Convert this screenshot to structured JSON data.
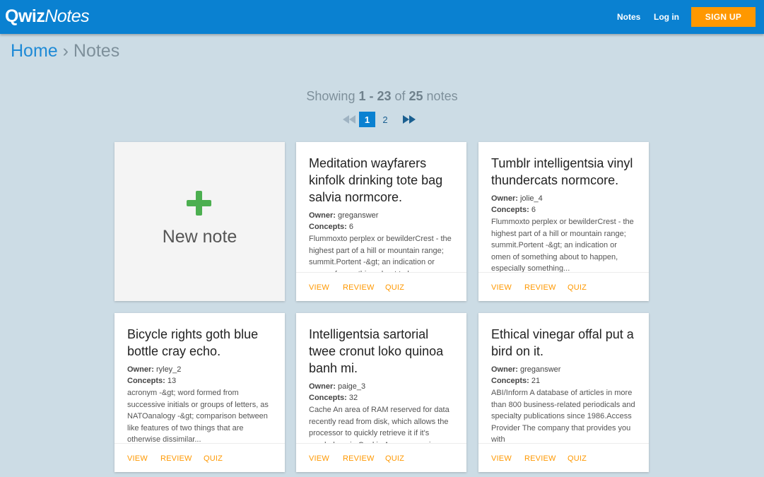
{
  "header": {
    "logo_bold": "Qwiz",
    "logo_italic": "Notes",
    "nav_notes": "Notes",
    "nav_login": "Log in",
    "signup": "SIGN UP"
  },
  "breadcrumb": {
    "home": "Home",
    "separator": " › ",
    "current": "Notes"
  },
  "listing": {
    "prefix": "Showing ",
    "range": "1 - 23",
    "of": " of ",
    "total": "25",
    "suffix": " notes"
  },
  "pagination": {
    "current_page": "1",
    "next_page": "2",
    "first_icon": "double-left-arrow-icon",
    "last_icon": "double-right-arrow-icon"
  },
  "new_note": {
    "label": "New note",
    "icon": "plus-icon"
  },
  "labels": {
    "owner": "Owner:",
    "concepts": "Concepts:",
    "view": "VIEW",
    "review": "REVIEW",
    "quiz": "QUIZ"
  },
  "notes": [
    {
      "title": "Meditation wayfarers kinfolk drinking tote bag salvia normcore.",
      "owner": " greganswer",
      "concepts": " 6",
      "description": "Flummoxto perplex or bewilderCrest - the highest part of a hill or mountain range; summit.Portent -&gt; an indication or omen of something about to happen"
    },
    {
      "title": "Tumblr intelligentsia vinyl thundercats normcore.",
      "owner": " jolie_4",
      "concepts": " 6",
      "description": "Flummoxto perplex or bewilderCrest - the highest part of a hill or mountain range; summit.Portent -&gt; an indication or omen of something about to happen, especially something..."
    },
    {
      "title": "Bicycle rights goth blue bottle cray echo.",
      "owner": " ryley_2",
      "concepts": " 13",
      "description": "acronym -&gt; word formed from successive initials or groups of letters, as NATOanalogy -&gt; comparison between like features of two things that are otherwise dissimilar..."
    },
    {
      "title": "Intelligentsia sartorial twee cronut loko quinoa banh mi.",
      "owner": " paige_3",
      "concepts": " 32",
      "description": "Cache An area of RAM reserved for data recently read from disk, which allows the processor to quickly retrieve it if it's needed again.Cookie A message given"
    },
    {
      "title": "Ethical vinegar offal put a bird on it.",
      "owner": " greganswer",
      "concepts": " 21",
      "description": "ABI/Inform A database of articles in more than 800 business-related periodicals and specialty publications since 1986.Access Provider The company that provides you with"
    }
  ],
  "colors": {
    "primary": "#0a81d1",
    "accent": "#ff9800",
    "background": "#ccdce5",
    "add_green": "#4caf50"
  }
}
